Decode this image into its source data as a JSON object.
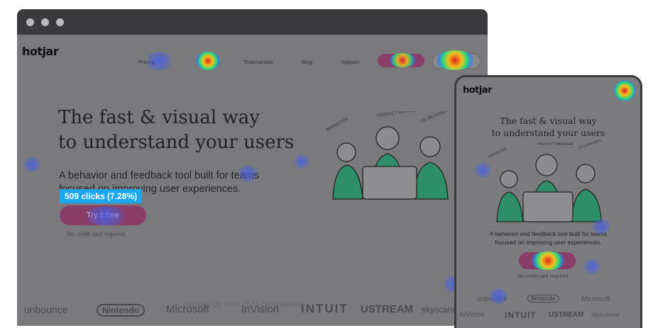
{
  "brand": {
    "logo_text": "hotjar"
  },
  "nav": {
    "items": [
      "Pricing",
      "Testimonials",
      "Blog",
      "Support"
    ]
  },
  "hero": {
    "title_line1": "The fast & visual way",
    "title_line2_prefix": "to ",
    "title_highlight": "understand your users",
    "description": "A behavior and feedback tool built for teams focused on improving user experiences.",
    "cta_label": "Try it free",
    "click_badge": "509 clicks (7.28%)",
    "no_cc": "No credit card required"
  },
  "illustration": {
    "labels": [
      "MARKETER",
      "PRODUCT MANAGER",
      "UX DESIGNER"
    ]
  },
  "trusted": "Trusted by over **,** companies",
  "logos": [
    "unbounce",
    "Nintendo",
    "Microsoft",
    "InVision",
    "INTUIT",
    "USTREAM",
    "skyscanner"
  ],
  "mobile": {
    "title_line1": "The fast & visual way",
    "title_line2_prefix": "to ",
    "title_highlight": "understand your users",
    "description_line1": "A behavior and feedback tool built for teams",
    "description_line2": "focused on improving user experiences.",
    "no_cc": "No credit card required",
    "logos_row1": [
      "unbounce",
      "Nintendo",
      "Microsoft"
    ],
    "logos_row2": [
      "InVision",
      "INTUIT",
      "USTREAM",
      "skyscanner"
    ]
  },
  "colors": {
    "accent_green": "#3b9f7a",
    "badge_blue": "#1aa7f0",
    "cta": "#8a3d67",
    "overlay": "#7a7a7c"
  }
}
